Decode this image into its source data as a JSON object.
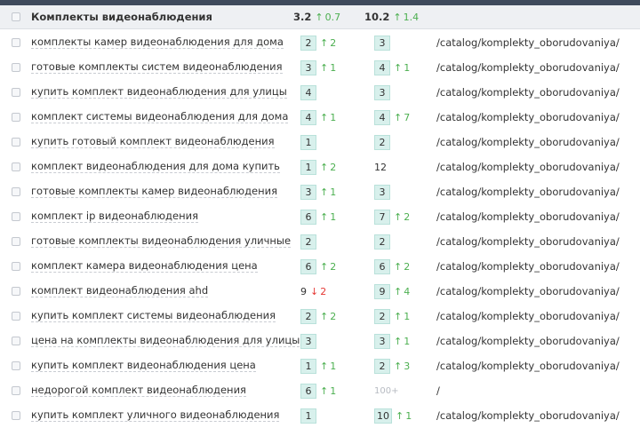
{
  "group": {
    "title": "Комплекты видеонаблюдения",
    "pos1": "3.2",
    "pos1_change": "0.7",
    "pos2": "10.2",
    "pos2_change": "1.4"
  },
  "rows": [
    {
      "keyword": "комплекты камер видеонаблюдения для дома",
      "p1": "2",
      "d1": "2",
      "t1": "up",
      "p2": "3",
      "d2": "",
      "t2": "",
      "url": "/catalog/komplekty_oborudovaniya/"
    },
    {
      "keyword": "готовые комплекты систем видеонаблюдения",
      "p1": "3",
      "d1": "1",
      "t1": "up",
      "p2": "4",
      "d2": "1",
      "t2": "up",
      "url": "/catalog/komplekty_oborudovaniya/"
    },
    {
      "keyword": "купить комплект видеонаблюдения для улицы",
      "p1": "4",
      "d1": "",
      "t1": "",
      "p2": "3",
      "d2": "",
      "t2": "",
      "url": "/catalog/komplekty_oborudovaniya/"
    },
    {
      "keyword": "комплект системы видеонаблюдения для дома",
      "p1": "4",
      "d1": "1",
      "t1": "up",
      "p2": "4",
      "d2": "7",
      "t2": "up",
      "url": "/catalog/komplekty_oborudovaniya/"
    },
    {
      "keyword": "купить готовый комплект видеонаблюдения",
      "p1": "1",
      "d1": "",
      "t1": "",
      "p2": "2",
      "d2": "",
      "t2": "",
      "url": "/catalog/komplekty_oborudovaniya/"
    },
    {
      "keyword": "комплект видеонаблюдения для дома купить",
      "p1": "1",
      "d1": "2",
      "t1": "up",
      "p2": "12",
      "p2_style": "plain",
      "d2": "",
      "t2": "",
      "url": "/catalog/komplekty_oborudovaniya/"
    },
    {
      "keyword": "готовые комплекты камер видеонаблюдения",
      "p1": "3",
      "d1": "1",
      "t1": "up",
      "p2": "3",
      "d2": "",
      "t2": "",
      "url": "/catalog/komplekty_oborudovaniya/"
    },
    {
      "keyword": "комплект ip видеонаблюдения",
      "p1": "6",
      "d1": "1",
      "t1": "up",
      "p2": "7",
      "d2": "2",
      "t2": "up",
      "url": "/catalog/komplekty_oborudovaniya/"
    },
    {
      "keyword": "готовые комплекты видеонаблюдения уличные",
      "p1": "2",
      "d1": "",
      "t1": "",
      "p2": "2",
      "d2": "",
      "t2": "",
      "url": "/catalog/komplekty_oborudovaniya/"
    },
    {
      "keyword": "комплект камера видеонаблюдения цена",
      "p1": "6",
      "d1": "2",
      "t1": "up",
      "p2": "6",
      "d2": "2",
      "t2": "up",
      "url": "/catalog/komplekty_oborudovaniya/"
    },
    {
      "keyword": "комплект видеонаблюдения ahd",
      "p1": "9",
      "p1_style": "plain",
      "d1": "2",
      "t1": "down",
      "p2": "9",
      "d2": "4",
      "t2": "up",
      "url": "/catalog/komplekty_oborudovaniya/"
    },
    {
      "keyword": "купить комплект системы видеонаблюдения",
      "p1": "2",
      "d1": "2",
      "t1": "up",
      "p2": "2",
      "d2": "1",
      "t2": "up",
      "url": "/catalog/komplekty_oborudovaniya/"
    },
    {
      "keyword": "цена на комплекты видеонаблюдения для улицы",
      "p1": "3",
      "d1": "",
      "t1": "",
      "p2": "3",
      "d2": "1",
      "t2": "up",
      "url": "/catalog/komplekty_oborudovaniya/"
    },
    {
      "keyword": "купить комплект видеонаблюдения цена",
      "p1": "1",
      "d1": "1",
      "t1": "up",
      "p2": "2",
      "d2": "3",
      "t2": "up",
      "url": "/catalog/komplekty_oborudovaniya/"
    },
    {
      "keyword": "недорогой комплект видеонаблюдения",
      "p1": "6",
      "d1": "1",
      "t1": "up",
      "p2": "100+",
      "p2_style": "muted",
      "d2": "",
      "t2": "",
      "url": "/"
    },
    {
      "keyword": "купить комплект уличного видеонаблюдения",
      "p1": "1",
      "d1": "",
      "t1": "",
      "p2": "10",
      "d2": "1",
      "t2": "up",
      "url": "/catalog/komplekty_oborudovaniya/"
    }
  ],
  "colors": {
    "up": "#4caf50",
    "down": "#e53935",
    "badge_bg": "#d8f0ec",
    "header_bg": "#eef0f3"
  },
  "icons": {
    "up": "arrow-up-icon",
    "down": "arrow-down-icon"
  }
}
